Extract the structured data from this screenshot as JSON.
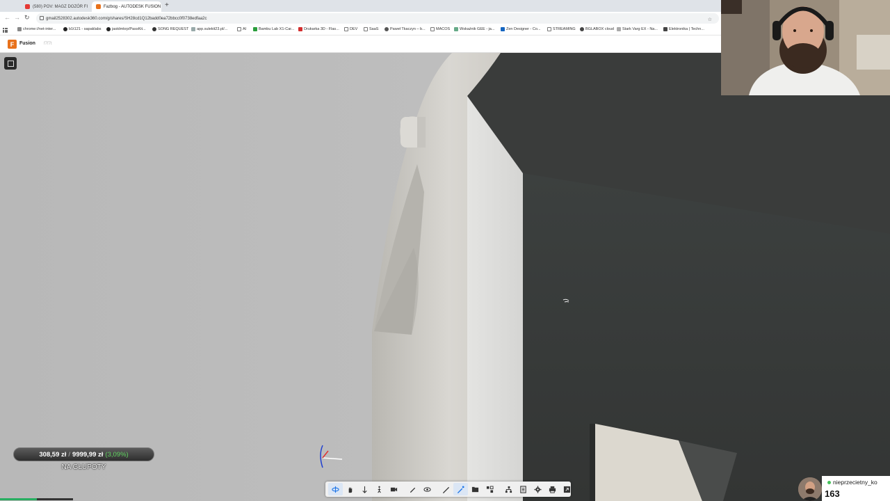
{
  "browser": {
    "tabs": [
      {
        "title": "(580) POV: MAGZ DOZÓR FI",
        "favicon_color": "#e53935",
        "active": false
      },
      {
        "title": "Fazbog - AUTODESK FUSION",
        "favicon_color": "#e8711b",
        "active": true
      }
    ],
    "new_tab_icon": "plus-icon",
    "url": "gmail2528302.autodesk360.com/g/shares/SH28cd1Q12badd0ea72bbcc0f0738edfaa2c",
    "bookmarks": [
      "chrome://net-inter...",
      "b1t121 - sapaklabs",
      "jastdmkrp/PassKit...",
      "SONG REQUEST",
      "app.sulekit23.pl/...",
      "AI",
      "Bambu Lab X1-Car...",
      "Drukarka 3D - Flas...",
      "DEV",
      "SaaS",
      "Paweł Tkaczyn – b...",
      "MACOS",
      "Wskaźnik GEE - ja...",
      "Zen Designer - Co...",
      "STREAMING",
      "BGLABOX cloud",
      "Stark Varg EX - Na...",
      "Elektronika | Techn..."
    ]
  },
  "app": {
    "logo_letter": "F",
    "name": "Fusion",
    "file": "f7f7t"
  },
  "overlay": {
    "budget": {
      "current": "308,59 zł",
      "separator": "/",
      "target": "9999,99 zł",
      "percent": "(3,09%)",
      "label": "NA GŁUPOTY",
      "progress_fraction": 0.0309
    },
    "follower": {
      "name": "nieprzecietny_ko",
      "count": "163"
    }
  },
  "toolbar": {
    "groups": [
      [
        "orbit-icon",
        "pan-icon",
        "zoom-icon",
        "walk-icon",
        "camera-icon"
      ],
      [
        "pen-icon",
        "eye-icon"
      ],
      [
        "markup-icon",
        "active-markup-icon",
        "section-icon",
        "explode-icon"
      ],
      [
        "model-tree-icon",
        "properties-icon",
        "settings-icon",
        "print-icon",
        "fullscreen-icon"
      ]
    ]
  },
  "colors": {
    "viewport_bg": "#bdbdbd",
    "part_dark": "#3a3d3c",
    "part_light": "#d8d8d6",
    "accent": "#e8711b",
    "active_tool": "#1a73e8"
  }
}
